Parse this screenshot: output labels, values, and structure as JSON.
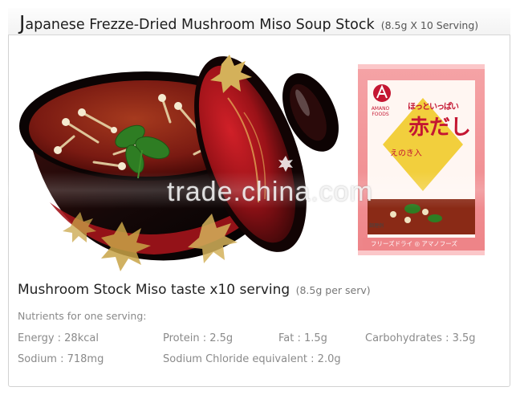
{
  "title": {
    "first_letter": "J",
    "main": "apanese Frezze-Dried Mushroom Miso Soup Stock",
    "sub": "(8.5g X 10 Serving)"
  },
  "watermark": "trade.china.com",
  "package": {
    "brand": "AMANO FOODS",
    "jp_top": "ほっといっぱい",
    "jp_main": "赤だし",
    "jp_sub": "えのき入",
    "jp_small": "調理例",
    "jp_footer": "フリーズドライ ◎ アマノフーズ"
  },
  "info": {
    "title": "Mushroom Stock Miso taste x10 serving",
    "sub": "(8.5g per serv)",
    "nutrients_heading": "Nutrients for one serving:",
    "nutrients": [
      "Energy : 28kcal",
      "Protein : 2.5g",
      "Fat : 1.5g",
      "Carbohydrates : 3.5g",
      "Sodium : 718mg",
      "Sodium Chloride equivalent : 2.0g"
    ]
  },
  "colors": {
    "lacquer_black": "#150808",
    "lacquer_red": "#b8141b",
    "soup": "#7a1a12",
    "package_pink": "#f08a8e",
    "package_yellow": "#f2cf3d"
  }
}
